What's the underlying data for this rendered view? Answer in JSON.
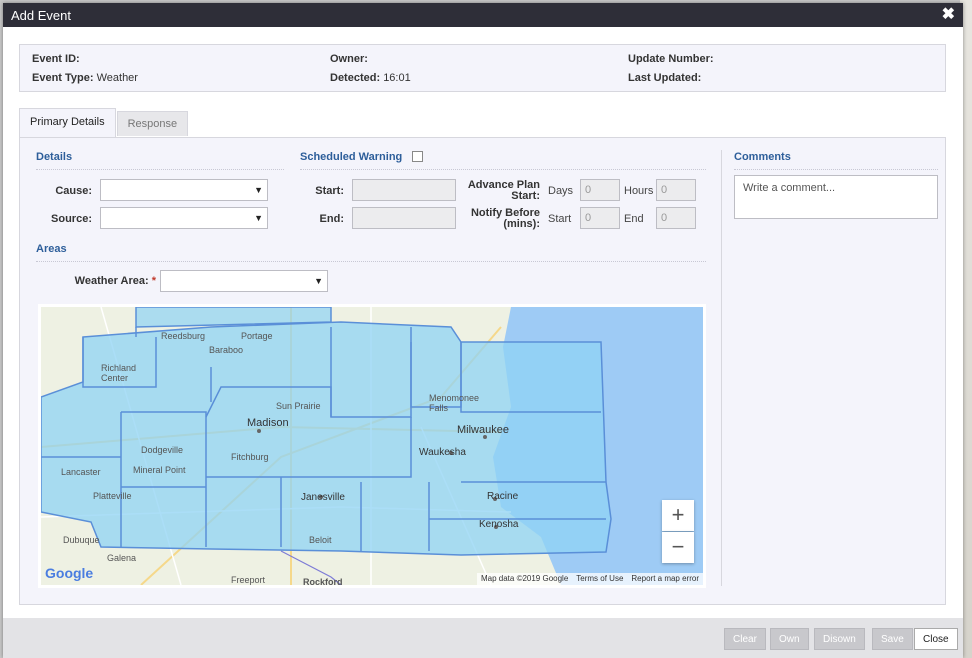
{
  "window": {
    "title": "Add Event"
  },
  "info": {
    "event_id_label": "Event ID:",
    "event_type_label": "Event Type:",
    "event_type_value": "Weather",
    "owner_label": "Owner:",
    "detected_label": "Detected:",
    "detected_value": "16:01",
    "update_number_label": "Update Number:",
    "last_updated_label": "Last Updated:"
  },
  "tabs": [
    {
      "label": "Primary Details"
    },
    {
      "label": "Response"
    }
  ],
  "details": {
    "title": "Details",
    "cause_label": "Cause:",
    "source_label": "Source:"
  },
  "areas": {
    "title": "Areas",
    "weather_area_label": "Weather Area:",
    "required_mark": "*"
  },
  "scheduled_warning": {
    "title": "Scheduled Warning",
    "start_label": "Start:",
    "end_label": "End:",
    "advance_plan_label_1": "Advance Plan",
    "advance_plan_label_2": "Start:",
    "days_label": "Days",
    "days_value": "0",
    "hours_label": "Hours",
    "hours_value": "0",
    "notify_label_1": "Notify Before",
    "notify_label_2": "(mins):",
    "notify_start_label": "Start",
    "notify_start_value": "0",
    "notify_end_label": "End",
    "notify_end_value": "0"
  },
  "comments": {
    "title": "Comments",
    "placeholder": "Write a comment..."
  },
  "map": {
    "cities": [
      "Madison",
      "Milwaukee",
      "Waukesha",
      "Janesville",
      "Racine",
      "Kenosha",
      "Dodgeville",
      "Fitchburg",
      "Sun Prairie",
      "Beloit",
      "Dubuque",
      "Galena",
      "Freeport",
      "Rockford",
      "Lancaster",
      "Platteville",
      "Mineral Point",
      "Portage",
      "Baraboo",
      "Reedsburg",
      "Richland Center",
      "Menomonee Falls"
    ],
    "zoom_in": "+",
    "zoom_out": "−",
    "attribution": "Map data ©2019 Google",
    "terms": "Terms of Use",
    "report": "Report a map error",
    "logo": "Google"
  },
  "footer": {
    "clear": "Clear",
    "own": "Own",
    "disown": "Disown",
    "save": "Save",
    "close": "Close"
  },
  "colors": {
    "title_bar": "#2e2e38",
    "section_title": "#2d5e9a",
    "map_overlay": "#8fd3f4"
  }
}
